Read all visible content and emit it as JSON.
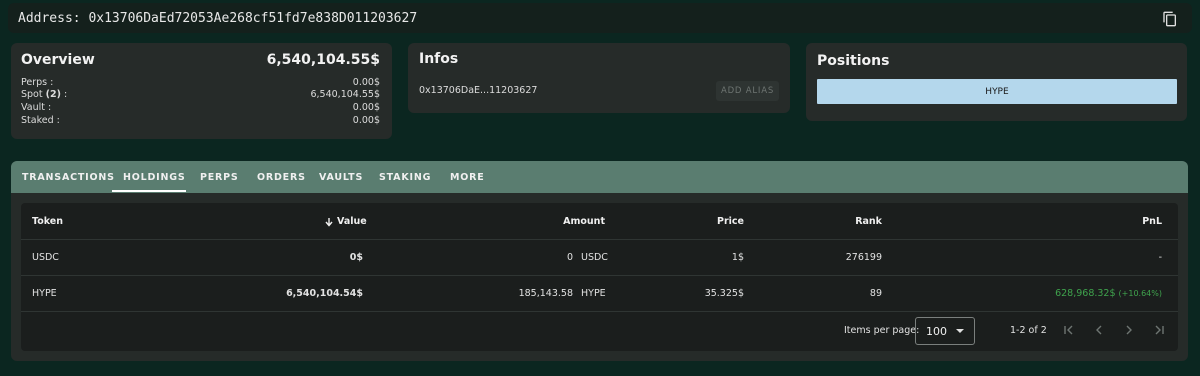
{
  "address_bar": {
    "label": "Address: 0x13706DaEd72053Ae268cf51fd7e838D011203627"
  },
  "overview": {
    "title": "Overview",
    "total": "6,540,104.55$",
    "rows": [
      {
        "label": "Perps :",
        "value": "0.00$"
      },
      {
        "label_prefix": "Spot ",
        "label_count": "(2)",
        "label_suffix": " :",
        "value": "6,540,104.55$"
      },
      {
        "label": "Vault :",
        "value": "0.00$"
      },
      {
        "label": "Staked :",
        "value": "0.00$"
      }
    ]
  },
  "infos": {
    "title": "Infos",
    "address_short": "0x13706DaE...11203627",
    "alias_button": "ADD ALIAS"
  },
  "positions": {
    "title": "Positions",
    "bar_label": "HYPE",
    "bar_color": "#b4d7ec"
  },
  "tabs": [
    {
      "label": "TRANSACTIONS"
    },
    {
      "label": "HOLDINGS",
      "active": true
    },
    {
      "label": "PERPS"
    },
    {
      "label": "ORDERS"
    },
    {
      "label": "VAULTS"
    },
    {
      "label": "STAKING"
    },
    {
      "label": "MORE"
    }
  ],
  "table": {
    "headers": {
      "token": "Token",
      "value": "Value",
      "amount": "Amount",
      "price": "Price",
      "rank": "Rank",
      "pnl": "PnL"
    },
    "sort_icon": "arrow-down-icon",
    "rows": [
      {
        "token": "USDC",
        "value": "0$",
        "amount": "0",
        "amount_unit": "USDC",
        "price": "1$",
        "rank": "276199",
        "pnl": "-",
        "pnl_pct": ""
      },
      {
        "token": "HYPE",
        "value": "6,540,104.54$",
        "amount": "185,143.58",
        "amount_unit": "HYPE",
        "price": "35.325$",
        "rank": "89",
        "pnl": "628,968.32$",
        "pnl_pct": "(+10.64%)"
      }
    ]
  },
  "paginator": {
    "items_per_page_label": "Items per page:",
    "page_size": "100",
    "range_label": "1-2 of 2"
  },
  "colors": {
    "background": "#0b2620",
    "tabbar": "#5a7d70",
    "positive": "#3fa34d"
  }
}
